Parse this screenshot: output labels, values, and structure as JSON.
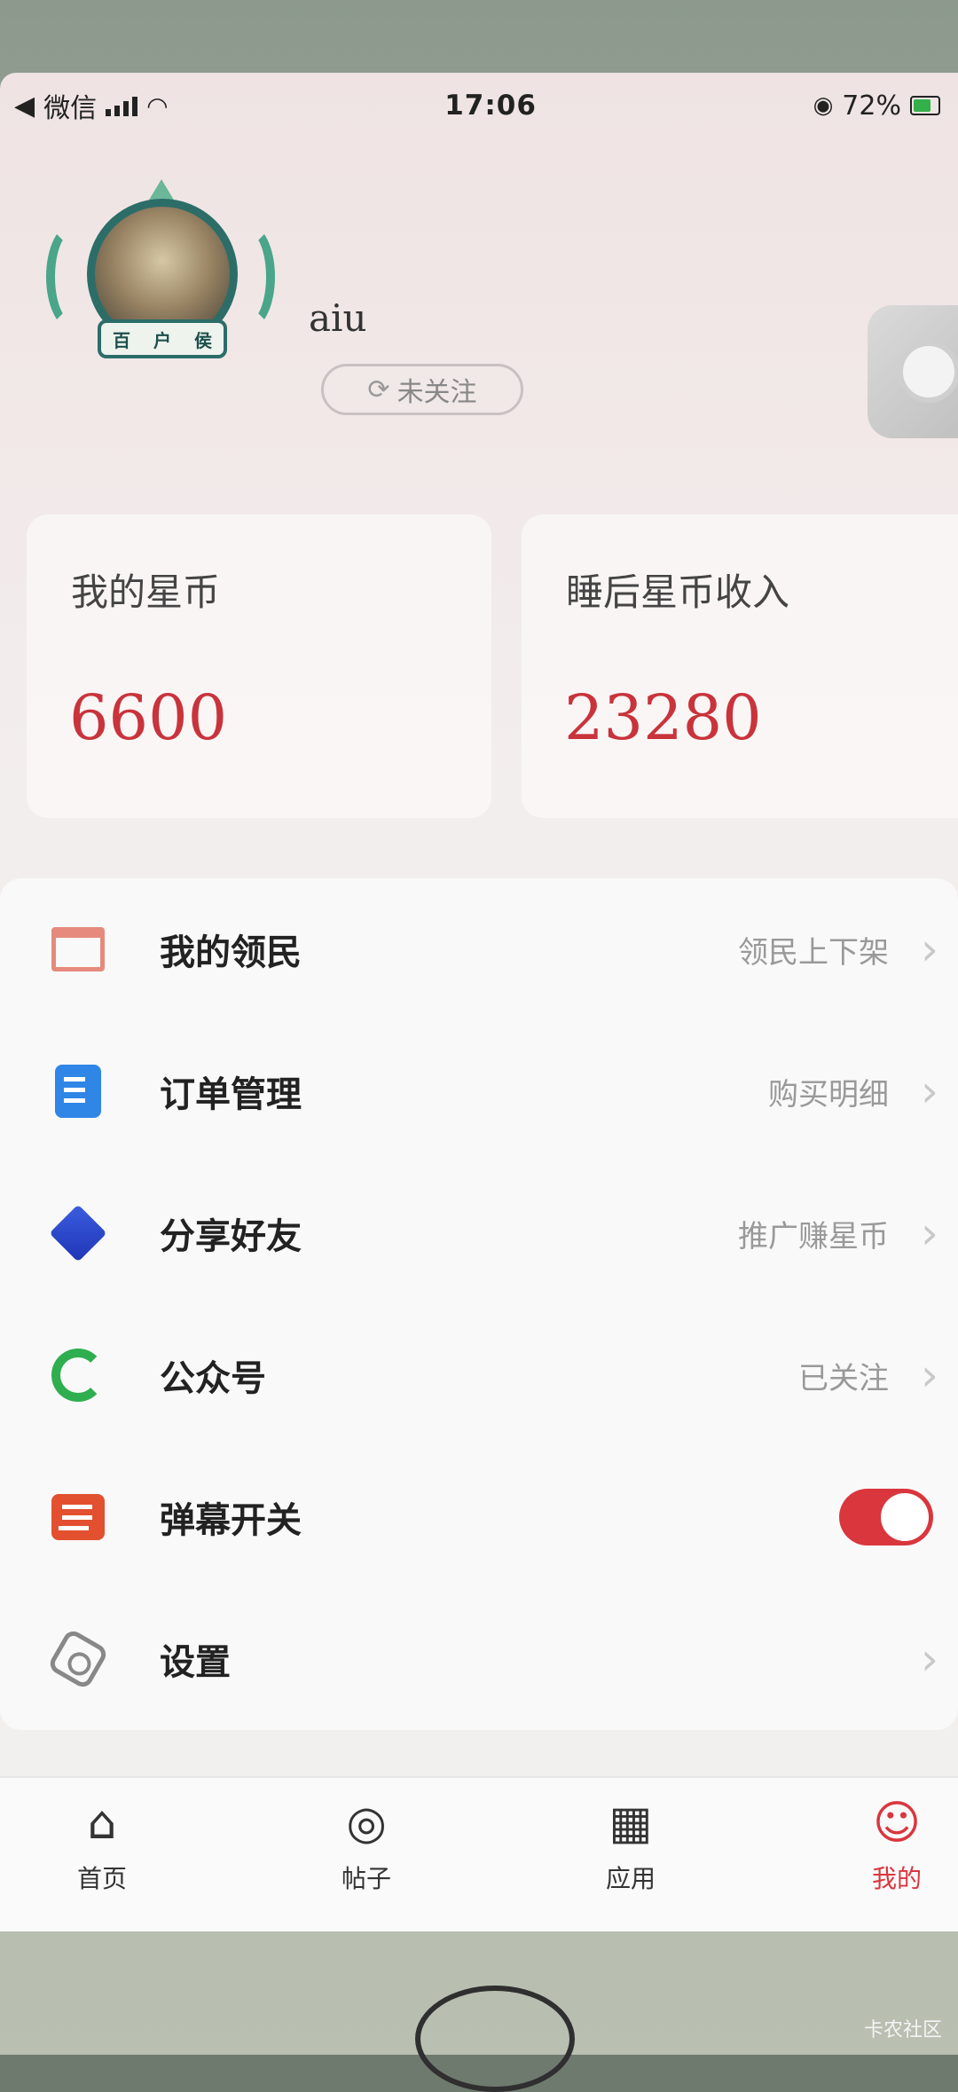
{
  "status_bar": {
    "back_app": "微信",
    "time": "17:06",
    "battery": "72%"
  },
  "profile": {
    "username": "aiu",
    "rank_chars": [
      "百",
      "户",
      "侯"
    ],
    "follow_label": "未关注"
  },
  "cards": [
    {
      "label": "我的星币",
      "value": "6600"
    },
    {
      "label": "睡后星币收入",
      "value": "23280"
    }
  ],
  "menu": [
    {
      "label": "我的领民",
      "sub": "领民上下架",
      "icon": "store-icon"
    },
    {
      "label": "订单管理",
      "sub": "购买明细",
      "icon": "document-edit-icon"
    },
    {
      "label": "分享好友",
      "sub": "推广赚星币",
      "icon": "cube-icon"
    },
    {
      "label": "公众号",
      "sub": "已关注",
      "icon": "wechat-official-icon"
    },
    {
      "label": "弹幕开关",
      "sub": "",
      "icon": "danmaku-icon",
      "toggle_on": true
    },
    {
      "label": "设置",
      "sub": "",
      "icon": "settings-hex-icon"
    }
  ],
  "tabs": [
    {
      "label": "首页",
      "icon": "home-icon"
    },
    {
      "label": "帖子",
      "icon": "posts-icon"
    },
    {
      "label": "应用",
      "icon": "apps-grid-icon"
    },
    {
      "label": "我的",
      "icon": "profile-icon",
      "active": true
    }
  ],
  "watermark": "卡农社区",
  "colors": {
    "accent": "#d9363e",
    "value_red": "#c9333b"
  }
}
